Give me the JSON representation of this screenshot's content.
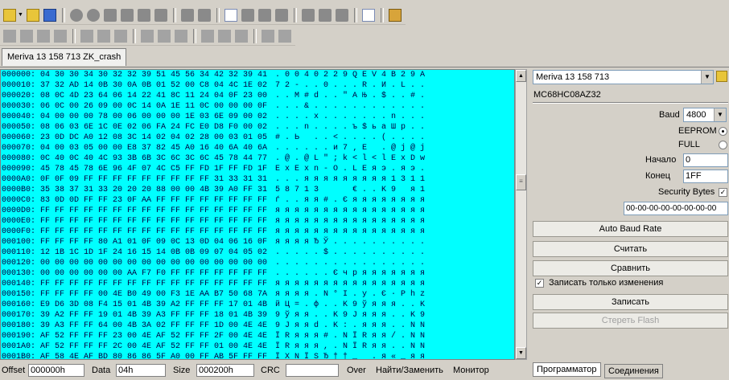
{
  "toolbar1": {
    "icons": [
      "new-icon",
      "open-icon",
      "save-icon",
      "record-icon",
      "stop-icon",
      "cut-icon",
      "copy-icon",
      "paste-icon",
      "delete-icon",
      "find-icon",
      "replace-icon",
      "document-icon",
      "page-icon",
      "page-alt-icon",
      "refresh-icon",
      "block-icon",
      "block-alt-icon",
      "grid-icon",
      "edit-icon",
      "settings-icon"
    ]
  },
  "toolbar2": {
    "icons": [
      "probe-icon",
      "probe-alt-icon",
      "chip-icon",
      "plug-icon",
      "mem1-icon",
      "mem2-icon",
      "mem3-icon",
      "mem4-icon",
      "mem5-icon",
      "mem6-icon",
      "cursor-icon",
      "select-icon",
      "target-icon",
      "run-icon",
      "stop-run-icon"
    ]
  },
  "tab": {
    "label": "Meriva 13 158 713 ZK_crash"
  },
  "hexview": {
    "rows": [
      {
        "offset": "000000:",
        "hex": "04 30 30 34 30 32 32 39 51 45 56 34 42 32 39 41",
        "ascii": ". 0 0 4 0 2 2 9 Q E V 4 B 2 9 A"
      },
      {
        "offset": "000010:",
        "hex": "37 32 AD 14 0B 30 0A 0B 01 52 00 C8 04 4C 1E 02",
        "ascii": "7 2 - . . 0 . . . R . И . L . ."
      },
      {
        "offset": "000020:",
        "hex": "08 0C 4D 23 64 06 14 22 41 8C 11 24 04 0F 23 00",
        "ascii": ". . M # d . . \" A Њ . $ . . # ."
      },
      {
        "offset": "000030:",
        "hex": "06 0C 00 26 09 00 0C 14 0A 1E 11 0C 00 00 00 0F",
        "ascii": ". . . & . . . . . . . . . . . ."
      },
      {
        "offset": "000040:",
        "hex": "04 00 00 00 78 00 06 00 00 00 1E 03 6E 09 00 02",
        "ascii": ". . . . x . . . . . . . n . . ."
      },
      {
        "offset": "000050:",
        "hex": "08 06 03 6E 1C 0E 02 06 FA 24 FC E0 D8 F0 00 02",
        "ascii": ". . . n . . . . ъ $ ь а Ш р . ."
      },
      {
        "offset": "000060:",
        "hex": "23 0D DC A0 12 08 3C 14 02 04 02 28 00 03 01 05",
        "ascii": "# . Ь   . . < . . . . ( . . . ."
      },
      {
        "offset": "000070:",
        "hex": "04 00 03 05 00 00 E8 37 82 45 A0 16 40 6A 40 6A",
        "ascii": ". . . . . . и 7 ‚ E   . @ j @ j"
      },
      {
        "offset": "000080:",
        "hex": "0C 40 0C 40 4C 93 3B 6B 3C 6C 3C 6C 45 78 44 77",
        "ascii": ". @ . @ L \" ; k < l < l E x D w"
      },
      {
        "offset": "000090:",
        "hex": "45 78 45 78 6E 96 4F 07 4C C5 FF FD 1F FF FD 1F",
        "ascii": "E x E x n - O . L E я э . я э ."
      },
      {
        "offset": "0000A0:",
        "hex": "0F 0F 09 FF FF FF FF FF FF FF FF FF 31 33 31 31",
        "ascii": ". . . я я я я я я я я я 1 3 1 1"
      },
      {
        "offset": "0000B0:",
        "hex": "35 38 37 31 33 20 20 20 88 00 00 4B 39 A0 FF 31",
        "ascii": "5 8 7 1 3       € . . K 9   я 1"
      },
      {
        "offset": "0000C0:",
        "hex": "83 0D 0D FF FF 23 0F AA FF FF FF FF FF FF FF FF",
        "ascii": "ѓ . . я я # . Є я я я я я я я я"
      },
      {
        "offset": "0000D0:",
        "hex": "FF FF FF FF FF FF FF FF FF FF FF FF FF FF FF FF",
        "ascii": "я я я я я я я я я я я я я я я я"
      },
      {
        "offset": "0000E0:",
        "hex": "FF FF FF FF FF FF FF FF FF FF FF FF FF FF FF FF",
        "ascii": "я я я я я я я я я я я я я я я я"
      },
      {
        "offset": "0000F0:",
        "hex": "FF FF FF FF FF FF FF FF FF FF FF FF FF FF FF FF",
        "ascii": "я я я я я я я я я я я я я я я я"
      },
      {
        "offset": "000100:",
        "hex": "FF FF FF FF 80 A1 01 0F 09 0C 13 0D 04 06 16 0F",
        "ascii": "я я я я Ђ Ў . . . . . . . . . ."
      },
      {
        "offset": "000110:",
        "hex": "12 1B 1C 1D 1F 24 16 15 14 0B 0B 09 07 04 05 02",
        "ascii": ". . . . . $ . . . . . . . . . ."
      },
      {
        "offset": "000120:",
        "hex": "00 00 00 00 00 00 00 00 00 00 00 00 00 00 00 00",
        "ascii": ". . . . . . . . . . . . . . . ."
      },
      {
        "offset": "000130:",
        "hex": "00 00 00 00 00 00 AA F7 F0 FF FF FF FF FF FF FF",
        "ascii": ". . . . . . Є ч р я я я я я я я"
      },
      {
        "offset": "000140:",
        "hex": "FF FF FF FF FF FF FF FF FF FF FF FF FF FF FF FF",
        "ascii": "я я я я я я я я я я я я я я я я"
      },
      {
        "offset": "000150:",
        "hex": "FF FF FF FF 00 4E B0 49 00 F3 1E AA B7 50 68 7A",
        "ascii": "я я я я . N ° I . у . Є · P h z"
      },
      {
        "offset": "000160:",
        "hex": "E9 D6 3D 08 F4 15 01 4B 39 A2 FF FF FF 17 01 4B",
        "ascii": "й Ц = . ф . . K 9 ў я я я . . K"
      },
      {
        "offset": "000170:",
        "hex": "39 A2 FF FF 19 01 4B 39 A3 FF FF FF 18 01 4B 39",
        "ascii": "9 ў я я . . K 9 Ј я я я . . K 9"
      },
      {
        "offset": "000180:",
        "hex": "39 A3 FF FF 64 00 4B 3A 02 FF FF FF 1D 00 4E 4E",
        "ascii": "9 Ј я я d . K : . я я я . . N N"
      },
      {
        "offset": "000190:",
        "hex": "AF 52 FF FF FF 23 00 4E AF 52 FF FF 2F 00 4E 4E",
        "ascii": "Ї R я я я # . N Ї R я я / . N N"
      },
      {
        "offset": "0001A0:",
        "hex": "AF 52 FF FF FF 2C 00 4E AF 52 FF FF 01 00 4E 4E",
        "ascii": "Ї R я я я , . N Ї R я я . . N N"
      },
      {
        "offset": "0001B0:",
        "hex": "AF 58 4E AF BD 80 86 86 5F A0 00 FF AB 5F FF FF",
        "ascii": "Ї X N Ї Ѕ Ђ † † _   . я « _ я я"
      }
    ]
  },
  "panel": {
    "device": "Meriva 13 158 713",
    "chip": "MC68HC08AZ32",
    "baud_label": "Baud",
    "baud_value": "4800",
    "eeprom_label": "EEPROM",
    "full_label": "FULL",
    "start_label": "Начало",
    "start_value": "0",
    "end_label": "Конец",
    "end_value": "1FF",
    "security_label": "Security Bytes",
    "security_value": "00-00-00-00-00-00-00-00",
    "btn_auto_baud": "Auto Baud Rate",
    "btn_read": "Считать",
    "btn_compare": "Сравнить",
    "write_changes_label": "Записать только изменения",
    "btn_write": "Записать",
    "btn_erase": "Стереть Flash"
  },
  "status": {
    "offset_label": "Offset",
    "offset_value": "000000h",
    "data_label": "Data",
    "data_value": "04h",
    "size_label": "Size",
    "size_value": "000200h",
    "crc_label": "CRC",
    "crc_value": "",
    "over_label": "Over",
    "find_replace_label": "Найти/Заменить",
    "monitor_label": "Монитор"
  },
  "bottom_tabs": [
    "Программатор",
    "Соединения"
  ]
}
